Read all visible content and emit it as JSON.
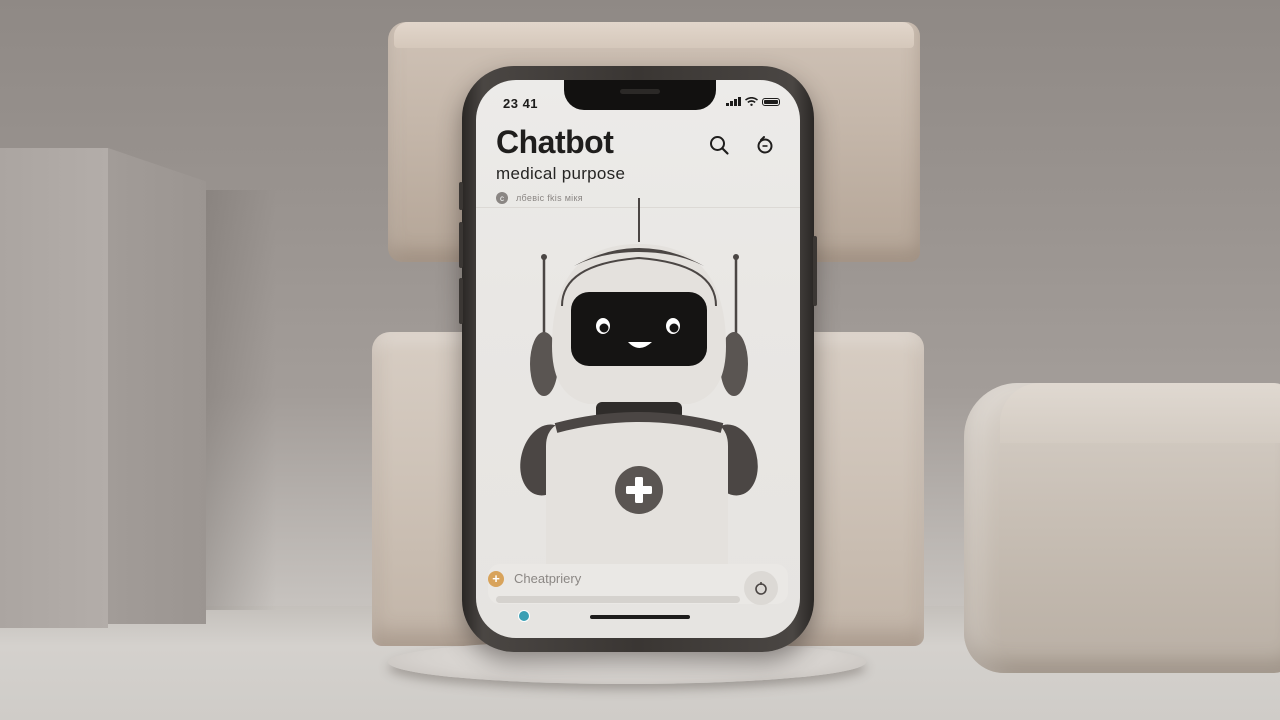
{
  "status_bar": {
    "time": "23 41"
  },
  "header": {
    "title": "Chatbot",
    "subtitle": "medical purpose",
    "tag_text": "лбевіс fkis мікя",
    "search_icon": "search-icon",
    "chat_icon": "chat-bubble-icon"
  },
  "robot": {
    "badge_icon": "medical-cross-icon"
  },
  "composer": {
    "placeholder": "Cheatpriery",
    "add_icon": "plus-icon",
    "send_icon": "mic-icon"
  },
  "colors": {
    "screen_bg": "#ecebe9",
    "robot_dark": "#4b4644",
    "robot_light": "#e4e1dd",
    "accent_plus": "#d8a35b",
    "accent_badge": "#3a9fb4",
    "clay": "#cfc2b6",
    "wall": "#8f8985"
  }
}
